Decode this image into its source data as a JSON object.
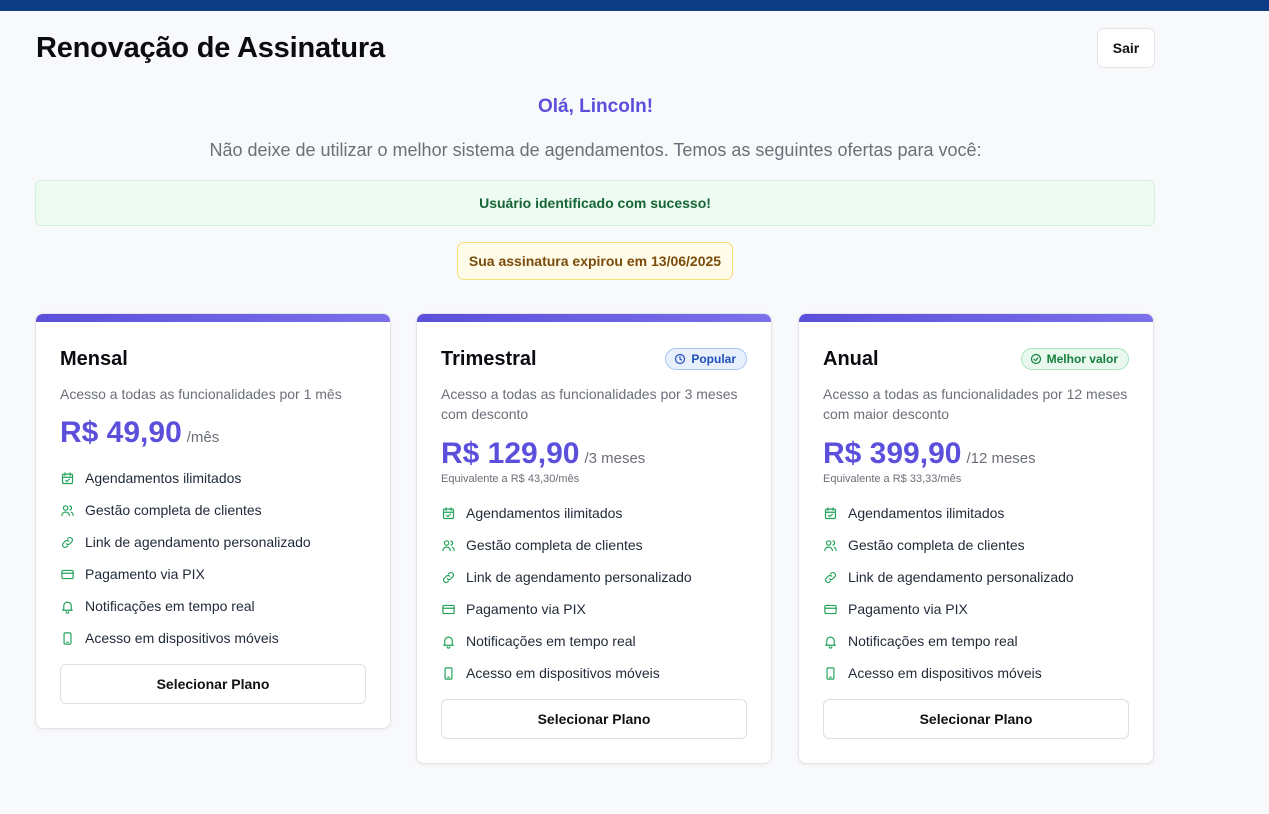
{
  "page": {
    "title": "Renovação de Assinatura",
    "logout_label": "Sair",
    "greeting": "Olá, Lincoln!",
    "subtitle": "Não deixe de utilizar o melhor sistema de agendamentos. Temos as seguintes ofertas para você:",
    "success_message": "Usuário identificado com sucesso!",
    "expired_message": "Sua assinatura expirou em 13/06/2025"
  },
  "colors": {
    "accent": "#5b4fdb",
    "topbar": "#0d3b84",
    "feature_icon": "#22a35a"
  },
  "plans": [
    {
      "name": "Mensal",
      "badge": "",
      "description": "Acesso a todas as funcionalidades por 1 mês",
      "price": "R$ 49,90",
      "period": "/mês",
      "equivalent": "",
      "button_label": "Selecionar Plano"
    },
    {
      "name": "Trimestral",
      "badge": "Popular",
      "badge_icon": "clock-icon",
      "description": "Acesso a todas as funcionalidades por 3 meses com desconto",
      "price": "R$ 129,90",
      "period": "/3 meses",
      "equivalent": "Equivalente a R$ 43,30/mês",
      "button_label": "Selecionar Plano"
    },
    {
      "name": "Anual",
      "badge": "Melhor valor",
      "badge_icon": "check-circle-icon",
      "description": "Acesso a todas as funcionalidades por 12 meses com maior desconto",
      "price": "R$ 399,90",
      "period": "/12 meses",
      "equivalent": "Equivalente a R$ 33,33/mês",
      "button_label": "Selecionar Plano"
    }
  ],
  "features": [
    {
      "label": "Agendamentos ilimitados",
      "icon": "calendar-check-icon"
    },
    {
      "label": "Gestão completa de clientes",
      "icon": "users-icon"
    },
    {
      "label": "Link de agendamento personalizado",
      "icon": "link-icon"
    },
    {
      "label": "Pagamento via PIX",
      "icon": "credit-card-icon"
    },
    {
      "label": "Notificações em tempo real",
      "icon": "bell-icon"
    },
    {
      "label": "Acesso em dispositivos móveis",
      "icon": "smartphone-icon"
    }
  ]
}
